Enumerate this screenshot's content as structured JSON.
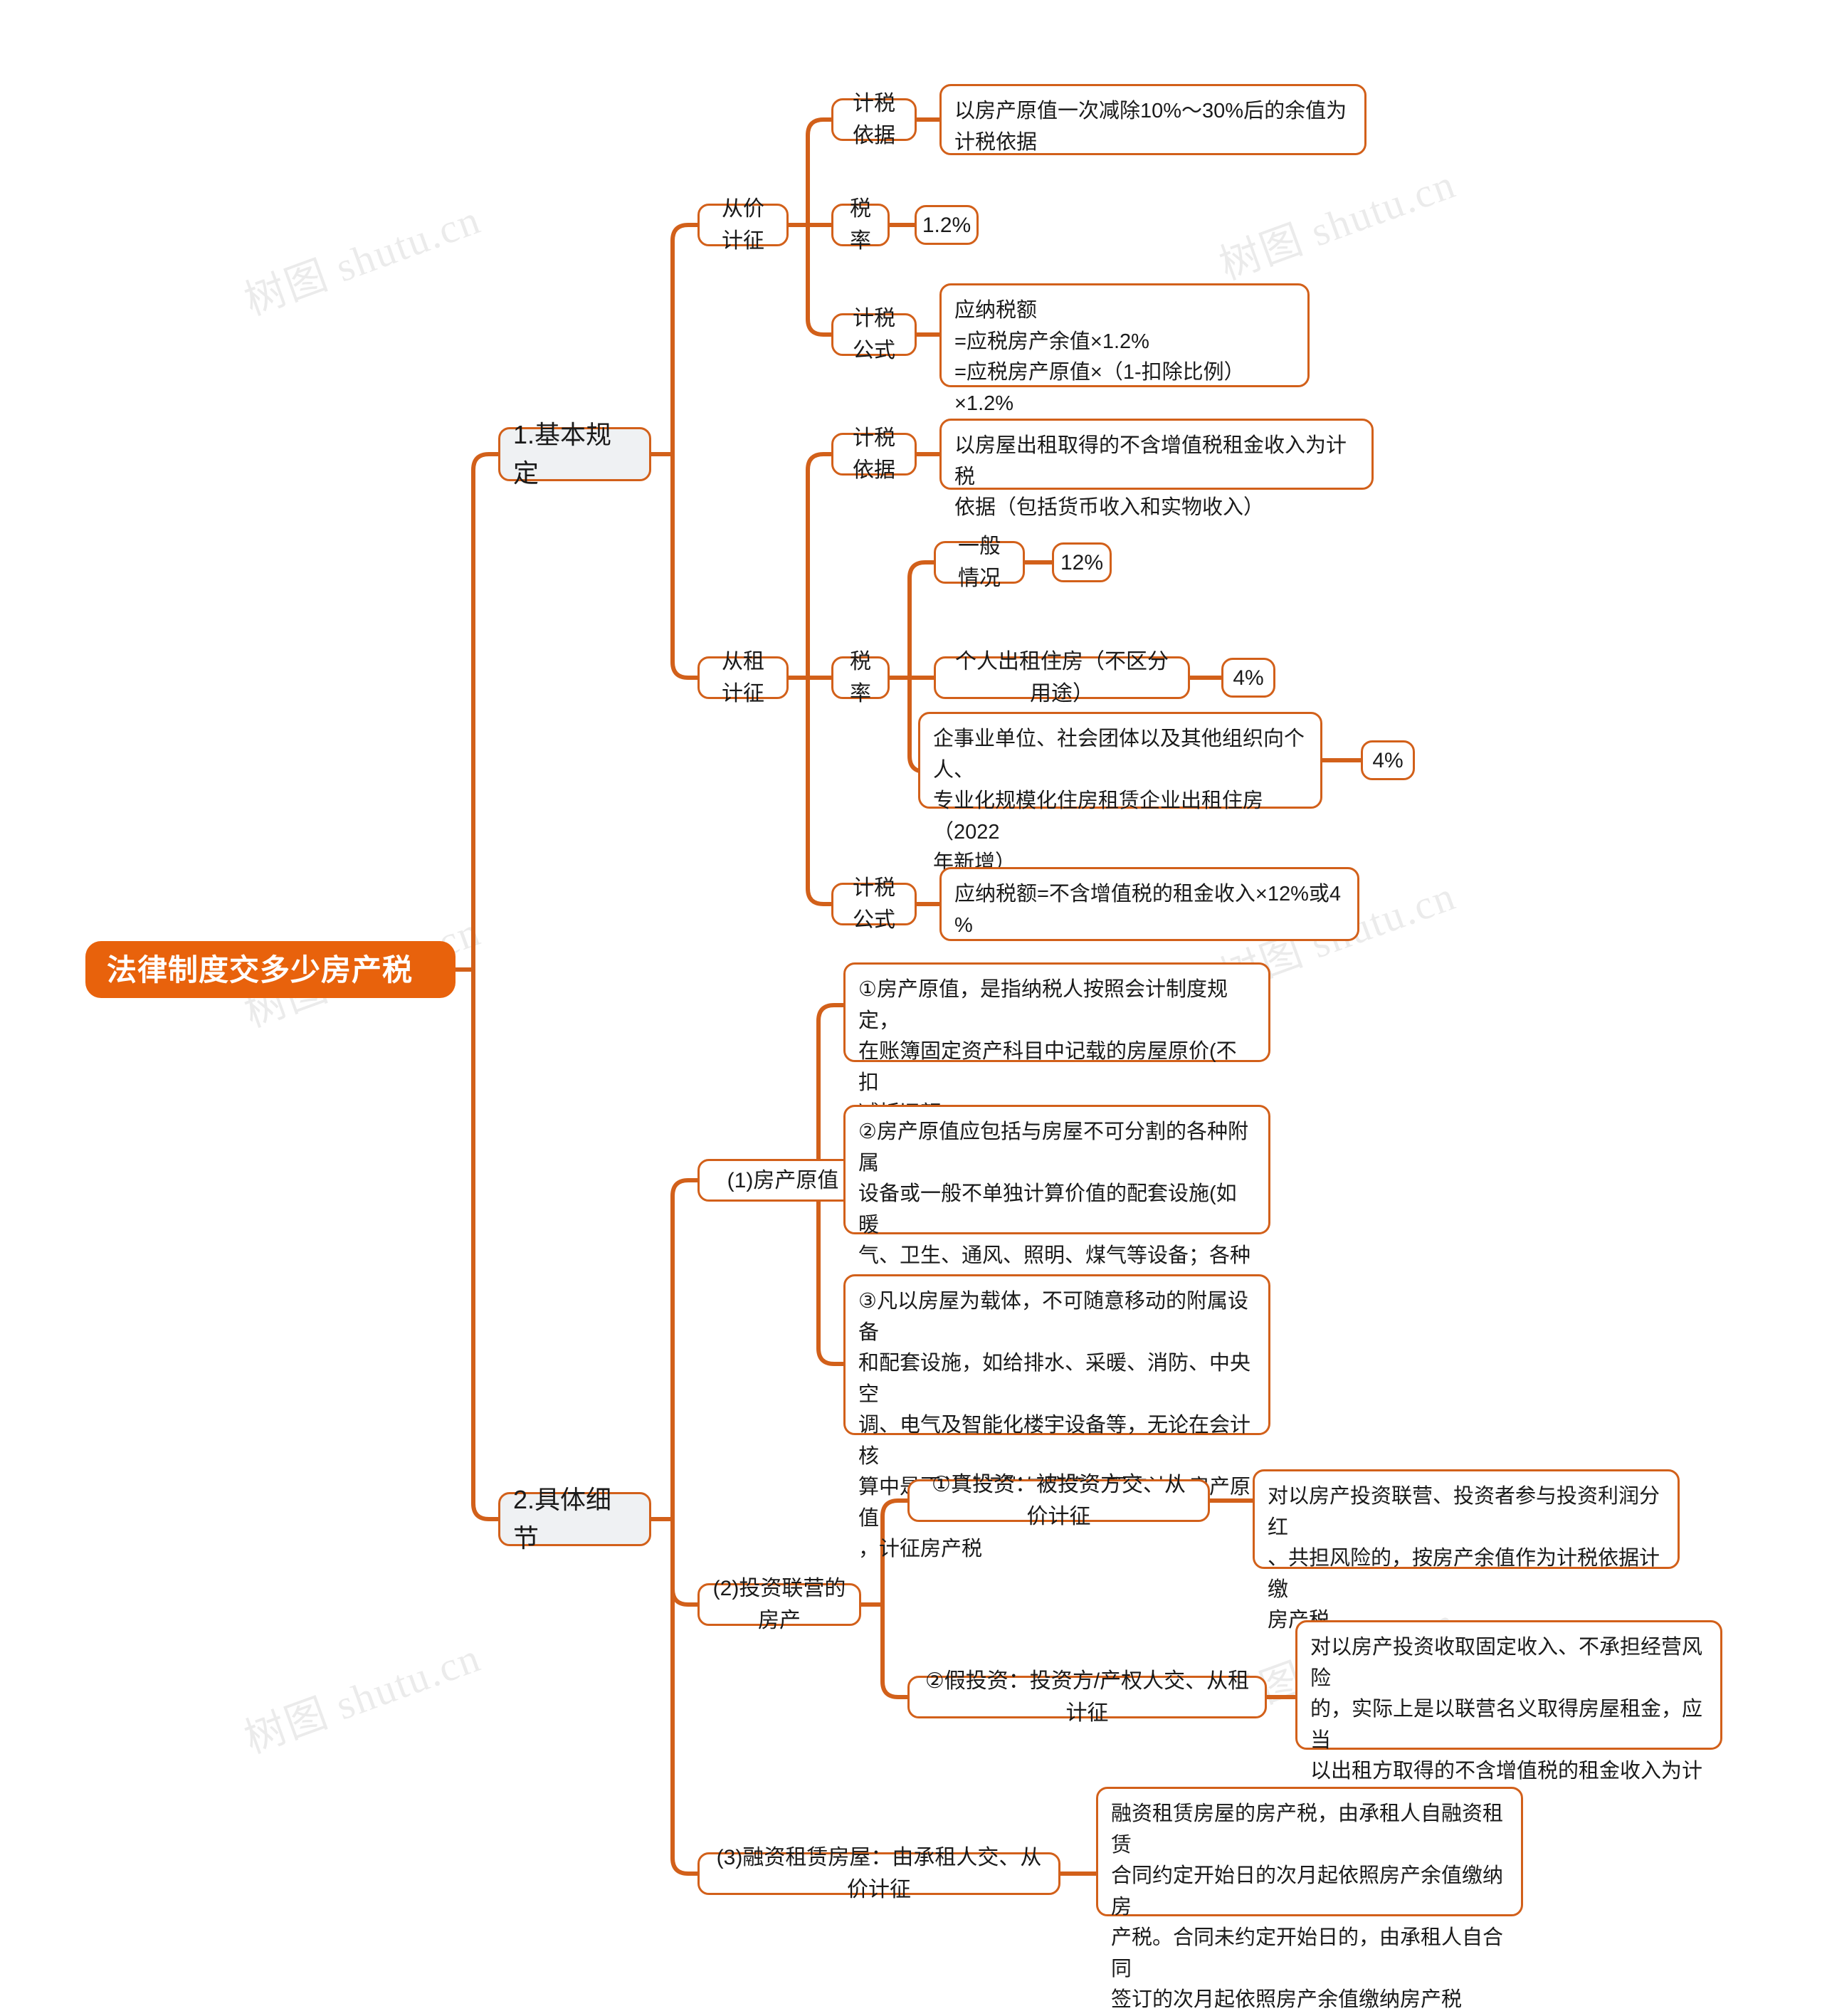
{
  "meta": {
    "title": "法律制度交多少房产税",
    "accent": "#E8620C",
    "border": "#D2601A",
    "level1_fill": "#EFF1F3",
    "watermark": "树图 shutu.cn"
  },
  "root": {
    "label": "法律制度交多少房产税"
  },
  "branches": [
    {
      "id": "basic",
      "label": "1.基本规定",
      "children": [
        {
          "id": "ad-valorem",
          "label": "从价计征",
          "children": [
            {
              "id": "basis1",
              "label": "计税依据",
              "detail": "以房产原值一次减除10%～30%后的余值为\n计税依据"
            },
            {
              "id": "rate1",
              "label": "税率",
              "value": "1.2%"
            },
            {
              "id": "formula1",
              "label": "计税公式",
              "detail": "应纳税额\n=应税房产余值×1.2%\n=应税房产原值×（1-扣除比例）×1.2%"
            }
          ]
        },
        {
          "id": "rental",
          "label": "从租计征",
          "children": [
            {
              "id": "basis2",
              "label": "计税依据",
              "detail": "以房屋出租取得的不含增值税租金收入为计税\n依据（包括货币收入和实物收入）"
            },
            {
              "id": "rate2",
              "label": "税率",
              "cases": [
                {
                  "label": "一般情况",
                  "value": "12%"
                },
                {
                  "label": "个人出租住房（不区分用途）",
                  "value": "4%"
                },
                {
                  "label": "企事业单位、社会团体以及其他组织向个人、\n专业化规模化住房租赁企业出租住房（2022\n年新增）",
                  "value": "4%"
                }
              ]
            },
            {
              "id": "formula2",
              "label": "计税公式",
              "detail": "应纳税额=不含增值税的租金收入×12%或4\n%"
            }
          ]
        }
      ]
    },
    {
      "id": "details",
      "label": "2.具体细节",
      "children": [
        {
          "id": "original-value",
          "label": "(1)房产原值",
          "notes": [
            "①房产原值，是指纳税人按照会计制度规定，\n在账簿固定资产科目中记载的房屋原价(不扣\n减折旧额)",
            "②房产原值应包括与房屋不可分割的各种附属\n设备或一般不单独计算价值的配套设施(如暖\n气、卫生、通风、照明、煤气等设备；各种管\n线；电梯、升降机、过道、晒台等)",
            "③凡以房屋为载体，不可随意移动的附属设备\n和配套设施，如给排水、采暖、消防、中央空\n调、电气及智能化楼宇设备等，无论在会计核\n算中是否单独记账与核算，都应计入房产原值\n，计征房产税"
          ]
        },
        {
          "id": "joint-venture",
          "label": "(2)投资联营的房产",
          "items": [
            {
              "label": "①真投资：被投资方交、从价计征",
              "detail": "对以房产投资联营、投资者参与投资利润分红\n、共担风险的，按房产余值作为计税依据计缴\n房产税"
            },
            {
              "label": "②假投资：投资方/产权人交、从租计征",
              "detail": "对以房产投资收取固定收入、不承担经营风险\n的，实际上是以联营名义取得房屋租金，应当\n以出租方取得的不含增值税的租金收入为计税\n依据计缴房产税"
            }
          ]
        },
        {
          "id": "finance-lease",
          "label": "(3)融资租赁房屋：由承租人交、从价计征",
          "detail": "融资租赁房屋的房产税，由承租人自融资租赁\n合同约定开始日的次月起依照房产余值缴纳房\n产税。合同未约定开始日的，由承租人自合同\n签订的次月起依照房产余值缴纳房产税"
        }
      ]
    }
  ]
}
